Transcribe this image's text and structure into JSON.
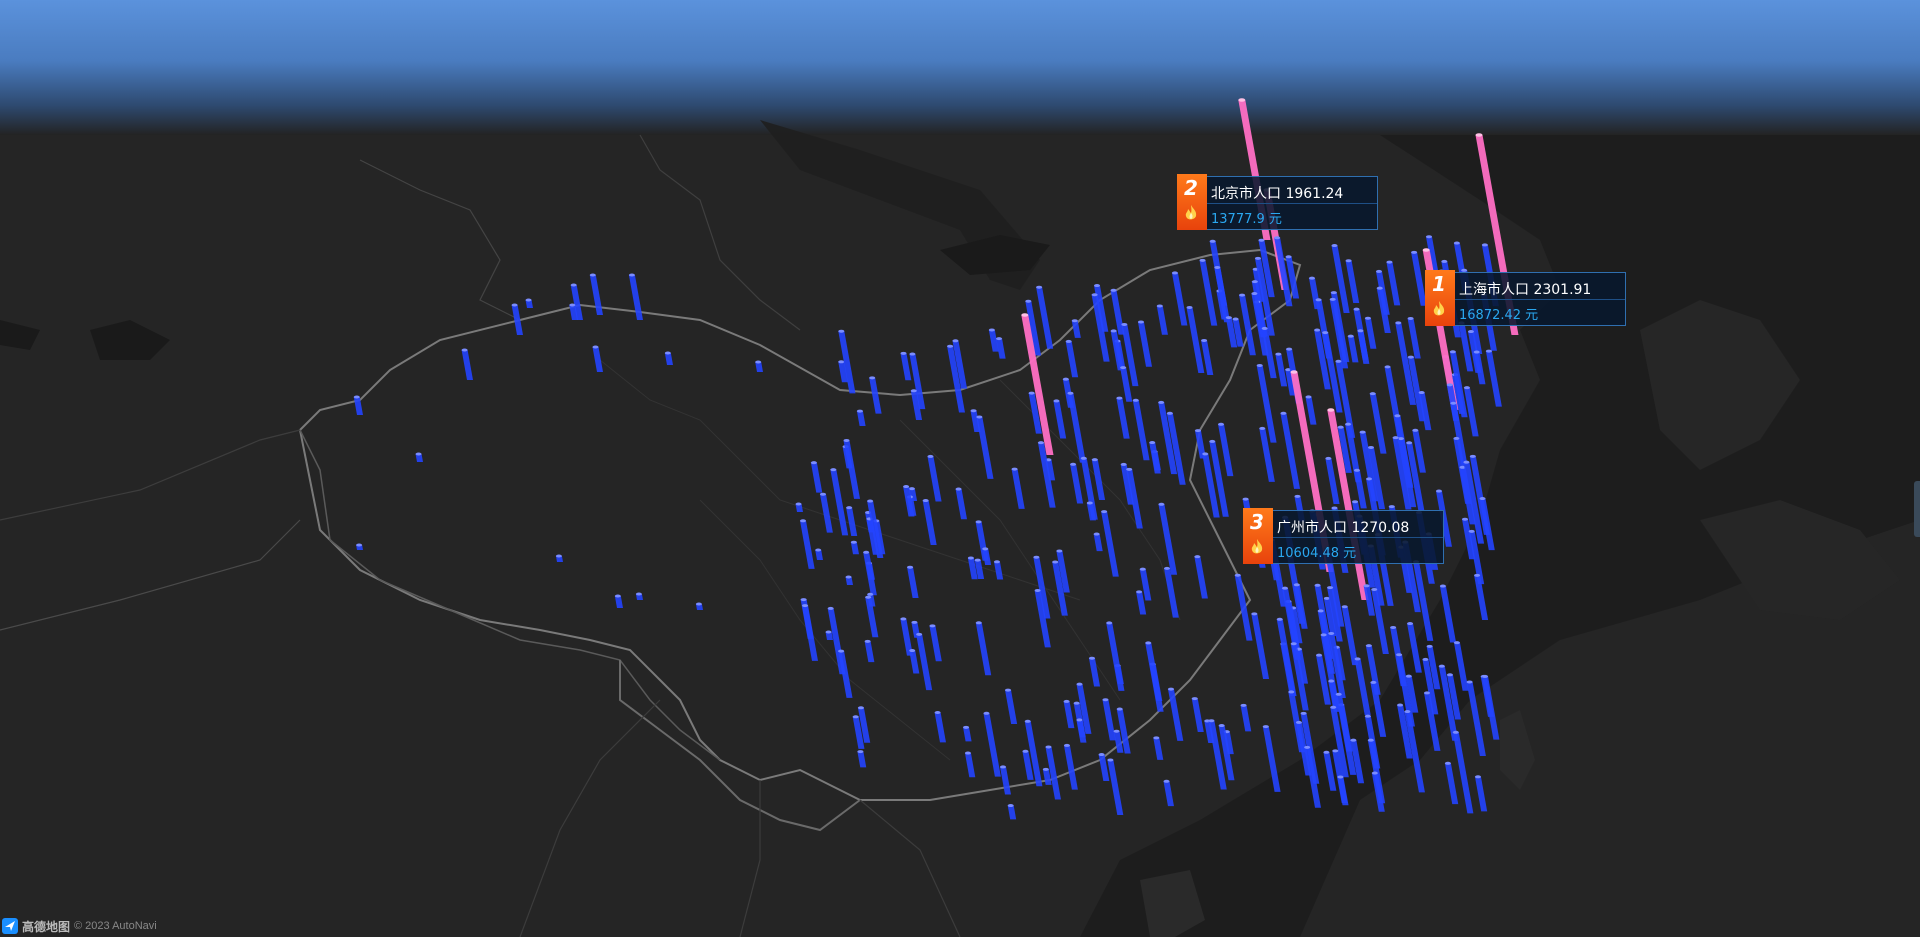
{
  "theme": {
    "sky_top": "#5b92dc",
    "ground": "#232323",
    "bar_blue": "#2344ff",
    "bar_pink": "#ff6fc4",
    "label_orange": "#f0561a",
    "label_value": "#2aa7f0"
  },
  "top_labels": [
    {
      "rank": "2",
      "title": "北京市人口 1961.24",
      "value": "13777.9 元",
      "icon": "flame-icon"
    },
    {
      "rank": "1",
      "title": "上海市人口 2301.91",
      "value": "16872.42 元",
      "icon": "flame-icon"
    },
    {
      "rank": "3",
      "title": "广州市人口 1270.08",
      "value": "10604.48 元",
      "icon": "flame-icon"
    }
  ],
  "footer": {
    "logo_text": "高德地图",
    "copyright": "© 2023 AutoNavi"
  }
}
